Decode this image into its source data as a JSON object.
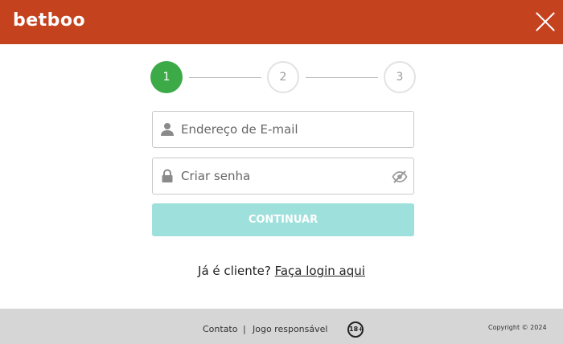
{
  "header": {
    "brand": "betboo",
    "close_icon": "close-icon",
    "bg_color": "#c5421f"
  },
  "steps": [
    {
      "label": "1",
      "state": "active"
    },
    {
      "label": "2",
      "state": "inactive"
    },
    {
      "label": "3",
      "state": "inactive"
    }
  ],
  "form": {
    "email": {
      "placeholder": "Endereço de E-mail",
      "value": "",
      "icon": "user-icon"
    },
    "password": {
      "placeholder": "Criar senha",
      "value": "",
      "icon": "lock-icon",
      "toggle_icon": "eye-slash-icon"
    },
    "continue_label": "CONTINUAR",
    "continue_color": "#9ee0dc"
  },
  "login": {
    "prompt": "Já é cliente?",
    "link": "Faça login aqui"
  },
  "footer": {
    "contact": "Contato",
    "separator": "|",
    "responsible": "Jogo responsável",
    "age_badge": "18+",
    "copyright": "Copyright © 2024"
  }
}
